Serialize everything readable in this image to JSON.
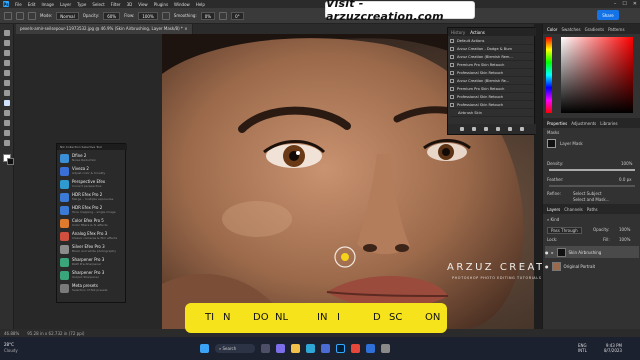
{
  "app": {
    "badge": "Ps"
  },
  "menubar": {
    "items": [
      "File",
      "Edit",
      "Image",
      "Layer",
      "Type",
      "Select",
      "Filter",
      "3D",
      "View",
      "Plugins",
      "Window",
      "Help"
    ],
    "window_controls": [
      "–",
      "☐",
      "✕"
    ]
  },
  "options": {
    "mode_label": "Mode:",
    "mode_value": "Normal",
    "opacity_label": "Opacity:",
    "opacity_value": "60%",
    "flow_label": "Flow:",
    "flow_value": "100%",
    "smoothing_label": "Smoothing:",
    "smoothing_value": "0%",
    "angle_value": "0°",
    "share_label": "Share"
  },
  "brand": {
    "text": "Visit - arzuzcreation.com"
  },
  "document": {
    "tab_title": "pexels-amir-seilsepour-11973532.jpg @ 46.9% (Skin Airbrushing, Layer Mask/8) *",
    "tab_close": "×"
  },
  "plugin_panel": {
    "header": "Nik Collection Selective Tool",
    "items": [
      {
        "name": "Dfine 2",
        "desc": "Noise Reduction",
        "color": "#3a8fd6"
      },
      {
        "name": "Viveza 2",
        "desc": "Adjust color & tonality",
        "color": "#3b6fd8"
      },
      {
        "name": "Perspective Efex",
        "desc": "Correct perspective",
        "color": "#2f9ad0"
      },
      {
        "name": "HDR Efex Pro 2",
        "desc": "Merge – multiple exposures",
        "color": "#3b7bd5"
      },
      {
        "name": "HDR Efex Pro 2",
        "desc": "Tone mapping – single image",
        "color": "#3b7bd5"
      },
      {
        "name": "Color Efex Pro 5",
        "desc": "Color filters & fx effects",
        "color": "#e07a2c"
      },
      {
        "name": "Analog Efex Pro 3",
        "desc": "Classic cameras & film effects",
        "color": "#d04f3f"
      },
      {
        "name": "Silver Efex Pro 3",
        "desc": "Black and white photography",
        "color": "#8c8c8c"
      },
      {
        "name": "Sharpener Pro 3",
        "desc": "RAW Pre-Sharpener",
        "color": "#3aa57a"
      },
      {
        "name": "Sharpener Pro 3",
        "desc": "Output Sharpener",
        "color": "#3aa57a"
      },
      {
        "name": "Meta presets",
        "desc": "Selection of Nik presets",
        "color": "#7a7a7a"
      }
    ]
  },
  "actions_panel": {
    "tabs": [
      "History",
      "Actions"
    ],
    "items": [
      "Default Actions",
      "Arzuz Creation - Dodge & Burn",
      "Arzuz Creation (Blemish Rem...",
      "Premium Pro Skin Retouch",
      "Professional Skin Retouch",
      "Arzuz Creation (Blemish Re...",
      "Premium Pro Skin Retouch",
      "Professional Skin Retouch",
      "Professional Skin Retouch",
      "Airbrush Skin"
    ]
  },
  "color_panel": {
    "tabs": [
      "Color",
      "Swatches",
      "Gradients",
      "Patterns"
    ]
  },
  "properties_panel": {
    "tabs": [
      "Properties",
      "Adjustments",
      "Libraries"
    ],
    "masks_label": "Masks",
    "mask_type": "Layer Mask",
    "density_label": "Density:",
    "density_value": "100%",
    "feather_label": "Feather:",
    "feather_value": "0.0 px",
    "refine_label": "Refine:",
    "select_subject": "Select Subject",
    "select_mask": "Select and Mask..."
  },
  "layers_panel": {
    "tabs": [
      "Layers",
      "Channels",
      "Paths"
    ],
    "kind_label": "Kind",
    "blend_value": "Pass Through",
    "opacity_label": "Opacity:",
    "opacity_value": "100%",
    "lock_label": "Lock:",
    "fill_label": "Fill:",
    "fill_value": "100%",
    "layers": [
      {
        "name": "Skin Airbrushing"
      },
      {
        "name": "Original Portrait"
      }
    ]
  },
  "status": {
    "zoom": "46.88%",
    "doc": "95.28 in x 62.732 in (72 ppi)"
  },
  "banner": {
    "parts": [
      "TI",
      "N",
      "DO",
      "NL",
      "IN",
      "I",
      "D",
      "SC",
      "ON"
    ]
  },
  "watermark": {
    "title": "ARZUZ CREATION",
    "subtitle": "PHOTOSHOP PHOTO EDITING TUTORIALS"
  },
  "taskbar": {
    "weather_temp": "28°C",
    "weather_desc": "Cloudy",
    "search_label": "Search",
    "lang": "ENG",
    "region": "INTL",
    "time": "9:43 PM",
    "date": "8/7/2023",
    "icons": [
      "windows-icon",
      "search-icon",
      "task-view-icon",
      "chat-icon",
      "explorer-icon",
      "edge-icon",
      "store-icon",
      "photoshop-icon",
      "chrome-icon",
      "mail-icon",
      "settings-icon"
    ]
  },
  "colors": {
    "accent": "#31a8ff",
    "share": "#1473e6",
    "banner": "#f6e31b",
    "skin": "#a97755"
  }
}
